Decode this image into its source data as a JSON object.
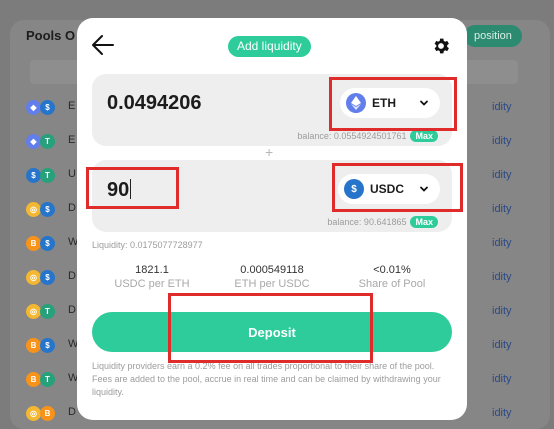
{
  "background": {
    "title": "Pools O",
    "position_button": "position",
    "rows": [
      {
        "letter": "E",
        "coin_left": "eth",
        "coin_right": "usdc",
        "link": "idity"
      },
      {
        "letter": "E",
        "coin_left": "eth",
        "coin_right": "usdt",
        "link": "idity"
      },
      {
        "letter": "U",
        "coin_left": "usdc",
        "coin_right": "usdt",
        "link": "idity"
      },
      {
        "letter": "D",
        "coin_left": "dai",
        "coin_right": "usdc",
        "link": "idity"
      },
      {
        "letter": "W",
        "coin_left": "btc",
        "coin_right": "usdc",
        "link": "idity"
      },
      {
        "letter": "D",
        "coin_left": "dai",
        "coin_right": "usdc",
        "link": "idity"
      },
      {
        "letter": "D",
        "coin_left": "dai",
        "coin_right": "usdt",
        "link": "idity"
      },
      {
        "letter": "W",
        "coin_left": "btc",
        "coin_right": "usdc",
        "link": "idity"
      },
      {
        "letter": "W",
        "coin_left": "btc",
        "coin_right": "usdt",
        "link": "idity"
      },
      {
        "letter": "D",
        "coin_left": "dai",
        "coin_right": "btc",
        "link": "idity"
      }
    ]
  },
  "modal": {
    "title": "Add liquidity",
    "back_icon": "arrow-left-icon",
    "settings_icon": "gear-icon",
    "input1": {
      "amount": "0.0494206",
      "token": "ETH",
      "token_icon": "eth-icon",
      "balance": "balance: 0.0554924501761",
      "max": "Max"
    },
    "plus": "+",
    "input2": {
      "amount": "90",
      "token": "USDC",
      "token_icon": "usdc-icon",
      "balance": "balance: 90.641865",
      "max": "Max"
    },
    "liquidity": "Liquidity: 0.0175077728977",
    "stats": [
      {
        "value": "1821.1",
        "label": "USDC per ETH"
      },
      {
        "value": "0.000549118",
        "label": "ETH per USDC"
      },
      {
        "value": "<0.01%",
        "label": "Share of Pool"
      }
    ],
    "deposit_label": "Deposit",
    "info": "Liquidity providers earn a 0.2% fee on all trades proportional to their share of the pool. Fees are added to the pool, accrue in real time and can be claimed by withdrawing your liquidity."
  },
  "colors": {
    "accent": "#2ecc9b",
    "annotation": "#e02b2b",
    "eth": "#627eea",
    "usdc": "#2775ca",
    "usdt": "#26a17b",
    "dai": "#f4b731",
    "btc": "#f7931a"
  }
}
